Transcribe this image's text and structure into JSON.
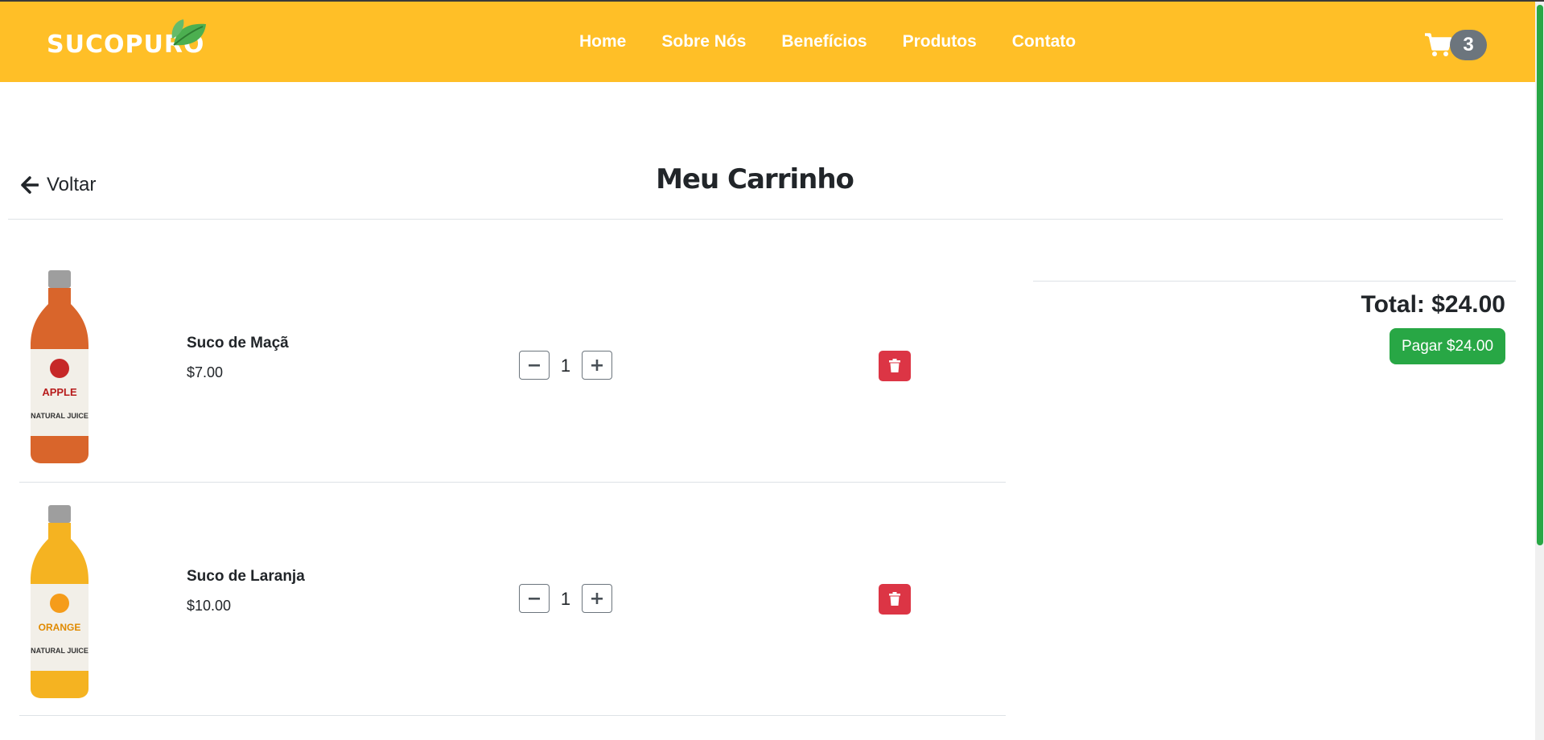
{
  "colors": {
    "brand": "#ffbf27",
    "accent_green": "#28a745",
    "danger": "#dc3545",
    "badge": "#6c757d"
  },
  "header": {
    "logo_text": "SUCOPURO",
    "nav": [
      "Home",
      "Sobre Nós",
      "Benefícios",
      "Produtos",
      "Contato"
    ],
    "cart_count": "3"
  },
  "page": {
    "back_label": "Voltar",
    "title": "Meu Carrinho"
  },
  "cart": {
    "items": [
      {
        "name": "Suco de Maçã",
        "price": "$7.00",
        "quantity": "1",
        "image_label": "APPLE",
        "image_sub": "NATURAL JUICE"
      },
      {
        "name": "Suco de Laranja",
        "price": "$10.00",
        "quantity": "1",
        "image_label": "ORANGE",
        "image_sub": "NATURAL JUICE"
      }
    ],
    "total_label": "Total: $24.00",
    "pay_label": "Pagar $24.00"
  },
  "icons": [
    "leaf-icon",
    "cart-icon",
    "arrow-left-icon",
    "minus-icon",
    "plus-icon",
    "trash-icon"
  ]
}
